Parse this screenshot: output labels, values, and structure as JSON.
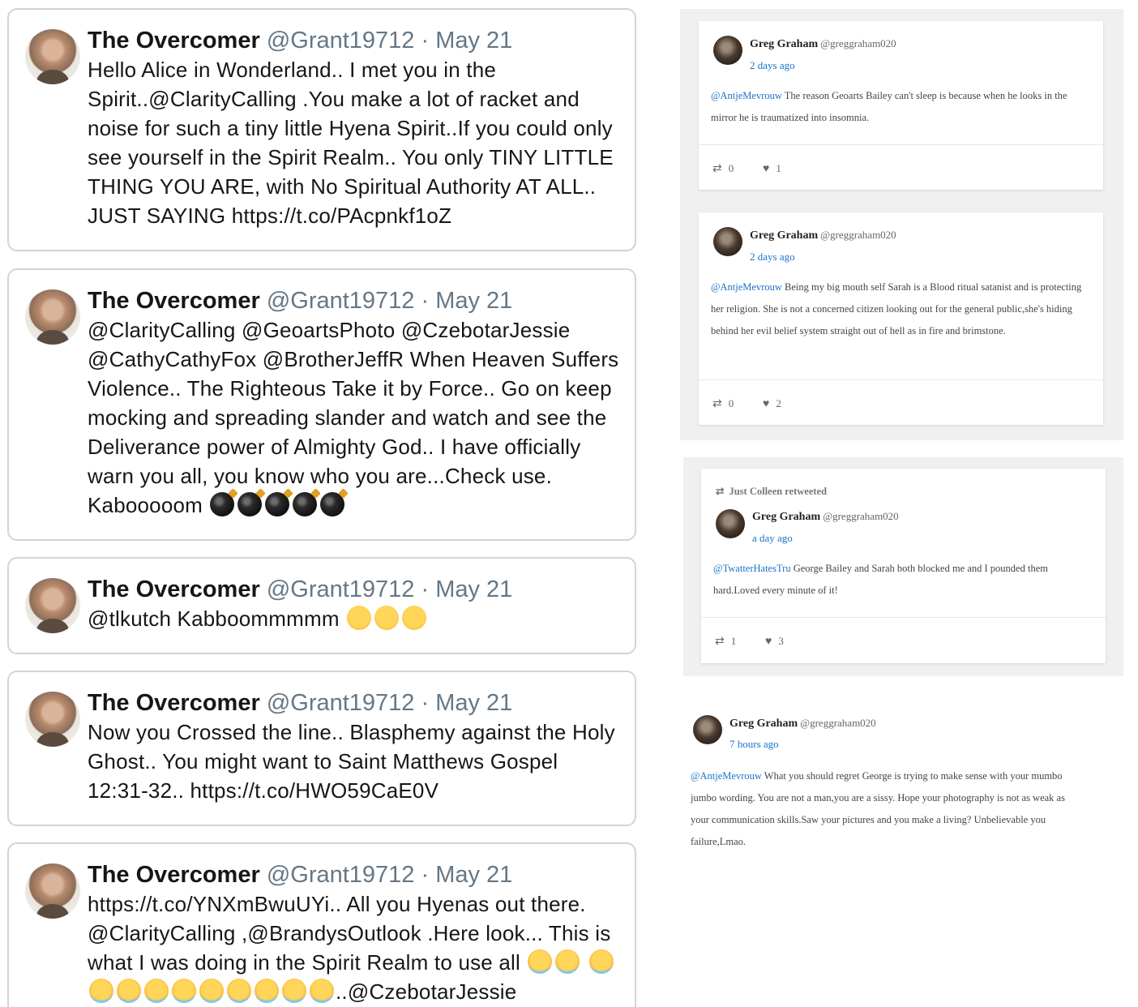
{
  "left_tweets": [
    {
      "name": "The Overcomer",
      "meta": "@Grant19712 · May 21",
      "text": "Hello Alice in Wonderland.. I met you in the Spirit..@ClarityCalling .You make a lot of racket and noise for such a tiny little Hyena Spirit..If you could only see yourself in the Spirit Realm.. You only TINY LITTLE THING YOU ARE, with No Spiritual Authority AT ALL.. JUST SAYING https://t.co/PAcpnkf1oZ"
    },
    {
      "name": "The Overcomer",
      "meta": "@Grant19712 · May 21",
      "text": "@ClarityCalling @GeoartsPhoto @CzebotarJessie @CathyCathyFox @BrotherJeffR When Heaven Suffers Violence.. The Righteous Take it by Force.. Go on keep mocking and spreading slander and watch and see the Deliverance power of Almighty God.. I have officially warn you all, you know who you are...Check use. Kabooooom"
    },
    {
      "name": "The Overcomer",
      "meta": "@Grant19712 · May 21",
      "text": "@tlkutch Kabboommmmm"
    },
    {
      "name": "The Overcomer",
      "meta": "@Grant19712 · May 21",
      "text": "Now you Crossed the line.. Blasphemy against the Holy Ghost.. You might want to Saint Matthews Gospel 12:31-32.. https://t.co/HWO59CaE0V"
    },
    {
      "name": "The Overcomer",
      "meta": "@Grant19712 · May 21",
      "text_a": "https://t.co/YNXmBwuUYi.. All you Hyenas out there. @ClarityCalling ,@BrandysOutlook .Here look... This is what I was doing in the Spirit Realm to use all",
      "text_b": "..@CzebotarJessie"
    }
  ],
  "right_posts": [
    {
      "name": "Greg Graham",
      "handle": "@greggraham020",
      "time": "2 days ago",
      "mention": "@AntjeMevrouw",
      "text": "The reason Geoarts Bailey can't sleep is because when he looks in the mirror he is traumatized into insomnia.",
      "retweets": "0",
      "likes": "1"
    },
    {
      "name": "Greg Graham",
      "handle": "@greggraham020",
      "time": "2 days ago",
      "mention": "@AntjeMevrouw",
      "text": "Being my big mouth self Sarah is a Blood ritual satanist and is protecting her religion. She is not a concerned citizen looking out for the general public,she's hiding behind her evil belief system straight out of hell as in fire and brimstone.",
      "retweets": "0",
      "likes": "2"
    },
    {
      "retweeted_by": "Just Colleen retweeted",
      "name": "Greg Graham",
      "handle": "@greggraham020",
      "time": "a day ago",
      "mention": "@TwatterHatesTru",
      "text": "George Bailey and Sarah both blocked me and I pounded them hard.Loved every minute of it!",
      "retweets": "1",
      "likes": "3"
    },
    {
      "name": "Greg Graham",
      "handle": "@greggraham020",
      "time": "7 hours ago",
      "mention": "@AntjeMevrouw",
      "text": "What you should regret George is trying to make sense with your mumbo jumbo wording. You are not a man,you are a sissy. Hope your photography is not as weak as your communication skills.Saw your pictures and you make a living? Unbelievable you failure,Lmao."
    }
  ],
  "icons": {
    "retweet": "retweet-icon",
    "like": "heart-icon",
    "bomb": "bomb-emoji",
    "smile": "smiling-face-emoji",
    "laugh": "tears-of-joy-emoji"
  }
}
